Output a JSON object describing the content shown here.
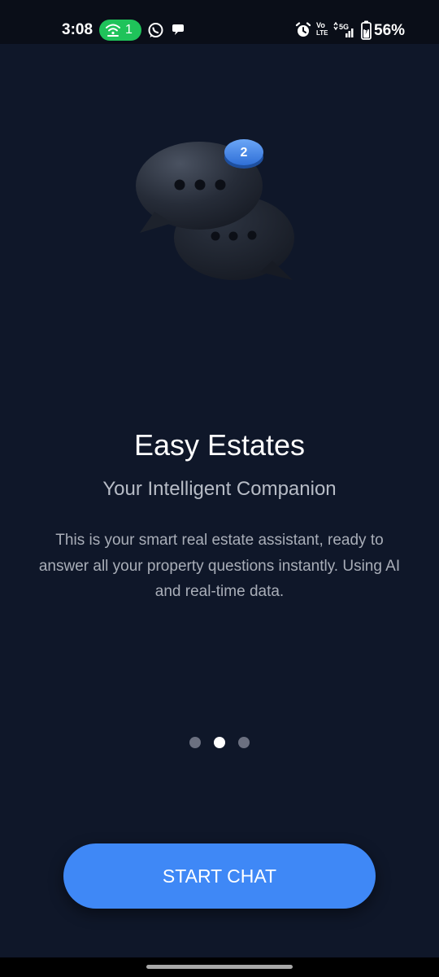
{
  "status_bar": {
    "time": "3:08",
    "hotspot_count": "1",
    "battery_percent": "56%",
    "volte_top": "Vo",
    "volte_bottom": "LTE",
    "network_label": "5G",
    "icons": [
      "wifi-hotspot-icon",
      "whatsapp-icon",
      "chat-notification-icon",
      "alarm-icon",
      "volte-icon",
      "signal-5g-icon",
      "battery-charging-icon"
    ],
    "hotspot_color": "#1fc35a"
  },
  "hero": {
    "badge_count": "2",
    "icon": "chat-bubbles-icon",
    "badge_color": "#3f88f6"
  },
  "onboarding": {
    "title": "Easy Estates",
    "subtitle": "Your Intelligent Companion",
    "description": "This is your smart real estate assistant, ready to answer all your property questions instantly. Using AI and real-time data.",
    "page_count": 3,
    "active_page": 2
  },
  "actions": {
    "start_chat_label": "START CHAT",
    "button_color": "#3f88f6"
  },
  "theme": {
    "background": "#0f1729"
  }
}
